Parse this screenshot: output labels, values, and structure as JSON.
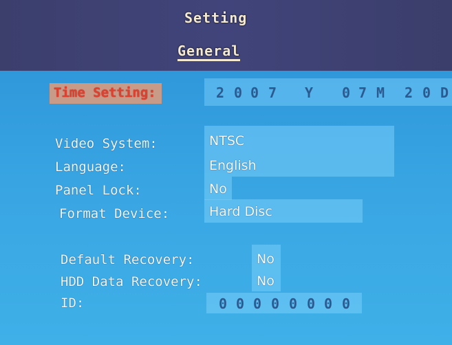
{
  "header": {
    "title": "Setting",
    "tab": "General"
  },
  "time_setting": {
    "label": "Time Setting:",
    "chars": [
      "2",
      "0",
      "0",
      "7",
      "Y",
      "0",
      "7",
      "M",
      "2",
      "0",
      "D"
    ]
  },
  "fields": {
    "video_system": {
      "label": "Video System:",
      "value": "NTSC"
    },
    "language": {
      "label": "Language:",
      "value": "English"
    },
    "panel_lock": {
      "label": "Panel Lock:",
      "value": "No"
    },
    "format_device": {
      "label": "Format Device:",
      "value": "Hard Disc"
    },
    "default_recovery": {
      "label": "Default Recovery:",
      "value": "No"
    },
    "hdd_data_recovery": {
      "label": "HDD Data Recovery:",
      "value": "No"
    },
    "id": {
      "label": "ID:",
      "digits": [
        "0",
        "0",
        "0",
        "0",
        "0",
        "0",
        "0",
        "0"
      ]
    }
  },
  "colors": {
    "header_bg": "#3c3f6c",
    "content_bg": "#39a6e3",
    "highlight_label_bg": "#c89b88",
    "highlight_label_text": "#e2402f",
    "text": "#f2f6fb"
  }
}
